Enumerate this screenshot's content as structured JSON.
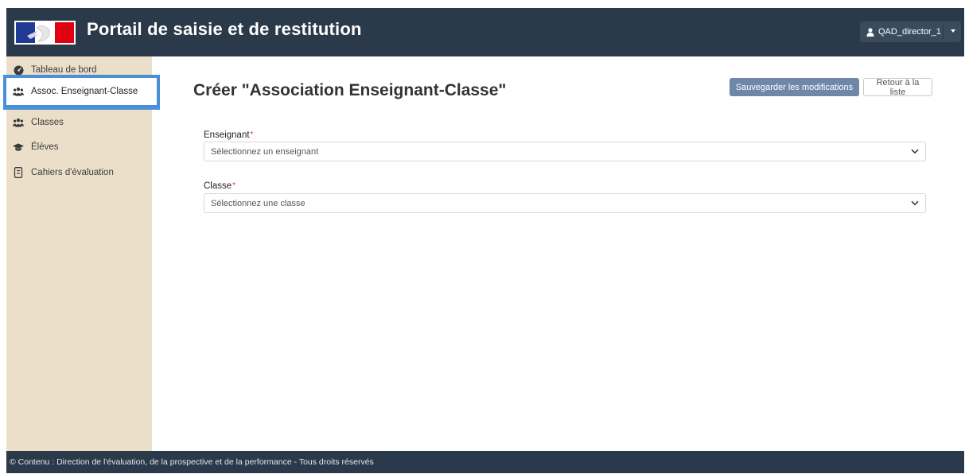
{
  "header": {
    "title": "Portail de saisie et de restitution",
    "logo_icon": "marianne-logo",
    "user": {
      "icon": "user-icon",
      "name": "QAD_director_1"
    }
  },
  "sidebar": {
    "items": [
      {
        "label": "Tableau de bord",
        "icon": "dashboard-icon",
        "active": false
      },
      {
        "label": "Assoc. Enseignant-Classe",
        "icon": "users-icon",
        "active": true
      },
      {
        "label": "Classes",
        "icon": "users-icon",
        "active": false
      },
      {
        "label": "Élèves",
        "icon": "graduation-cap-icon",
        "active": false
      },
      {
        "label": "Cahiers d'évaluation",
        "icon": "notebook-icon",
        "active": false
      }
    ]
  },
  "main": {
    "title": "Créer \"Association Enseignant-Classe\"",
    "save_label": "Sauvegarder les modifications",
    "back_label": "Retour à la liste",
    "fields": [
      {
        "label": "Enseignant",
        "required": "*",
        "placeholder": "Sélectionnez un enseignant"
      },
      {
        "label": "Classe",
        "required": "*",
        "placeholder": "Sélectionnez une classe"
      }
    ]
  },
  "footer": {
    "text": "© Contenu : Direction de l'évaluation, de la prospective et de la performance - Tous droits réservés"
  },
  "colors": {
    "header_bg": "#2b3a4a",
    "sidebar_bg": "#ecdfca",
    "active_highlight": "#4a90d9",
    "primary_button": "#6f88a7",
    "required_marker": "#d8392b"
  }
}
